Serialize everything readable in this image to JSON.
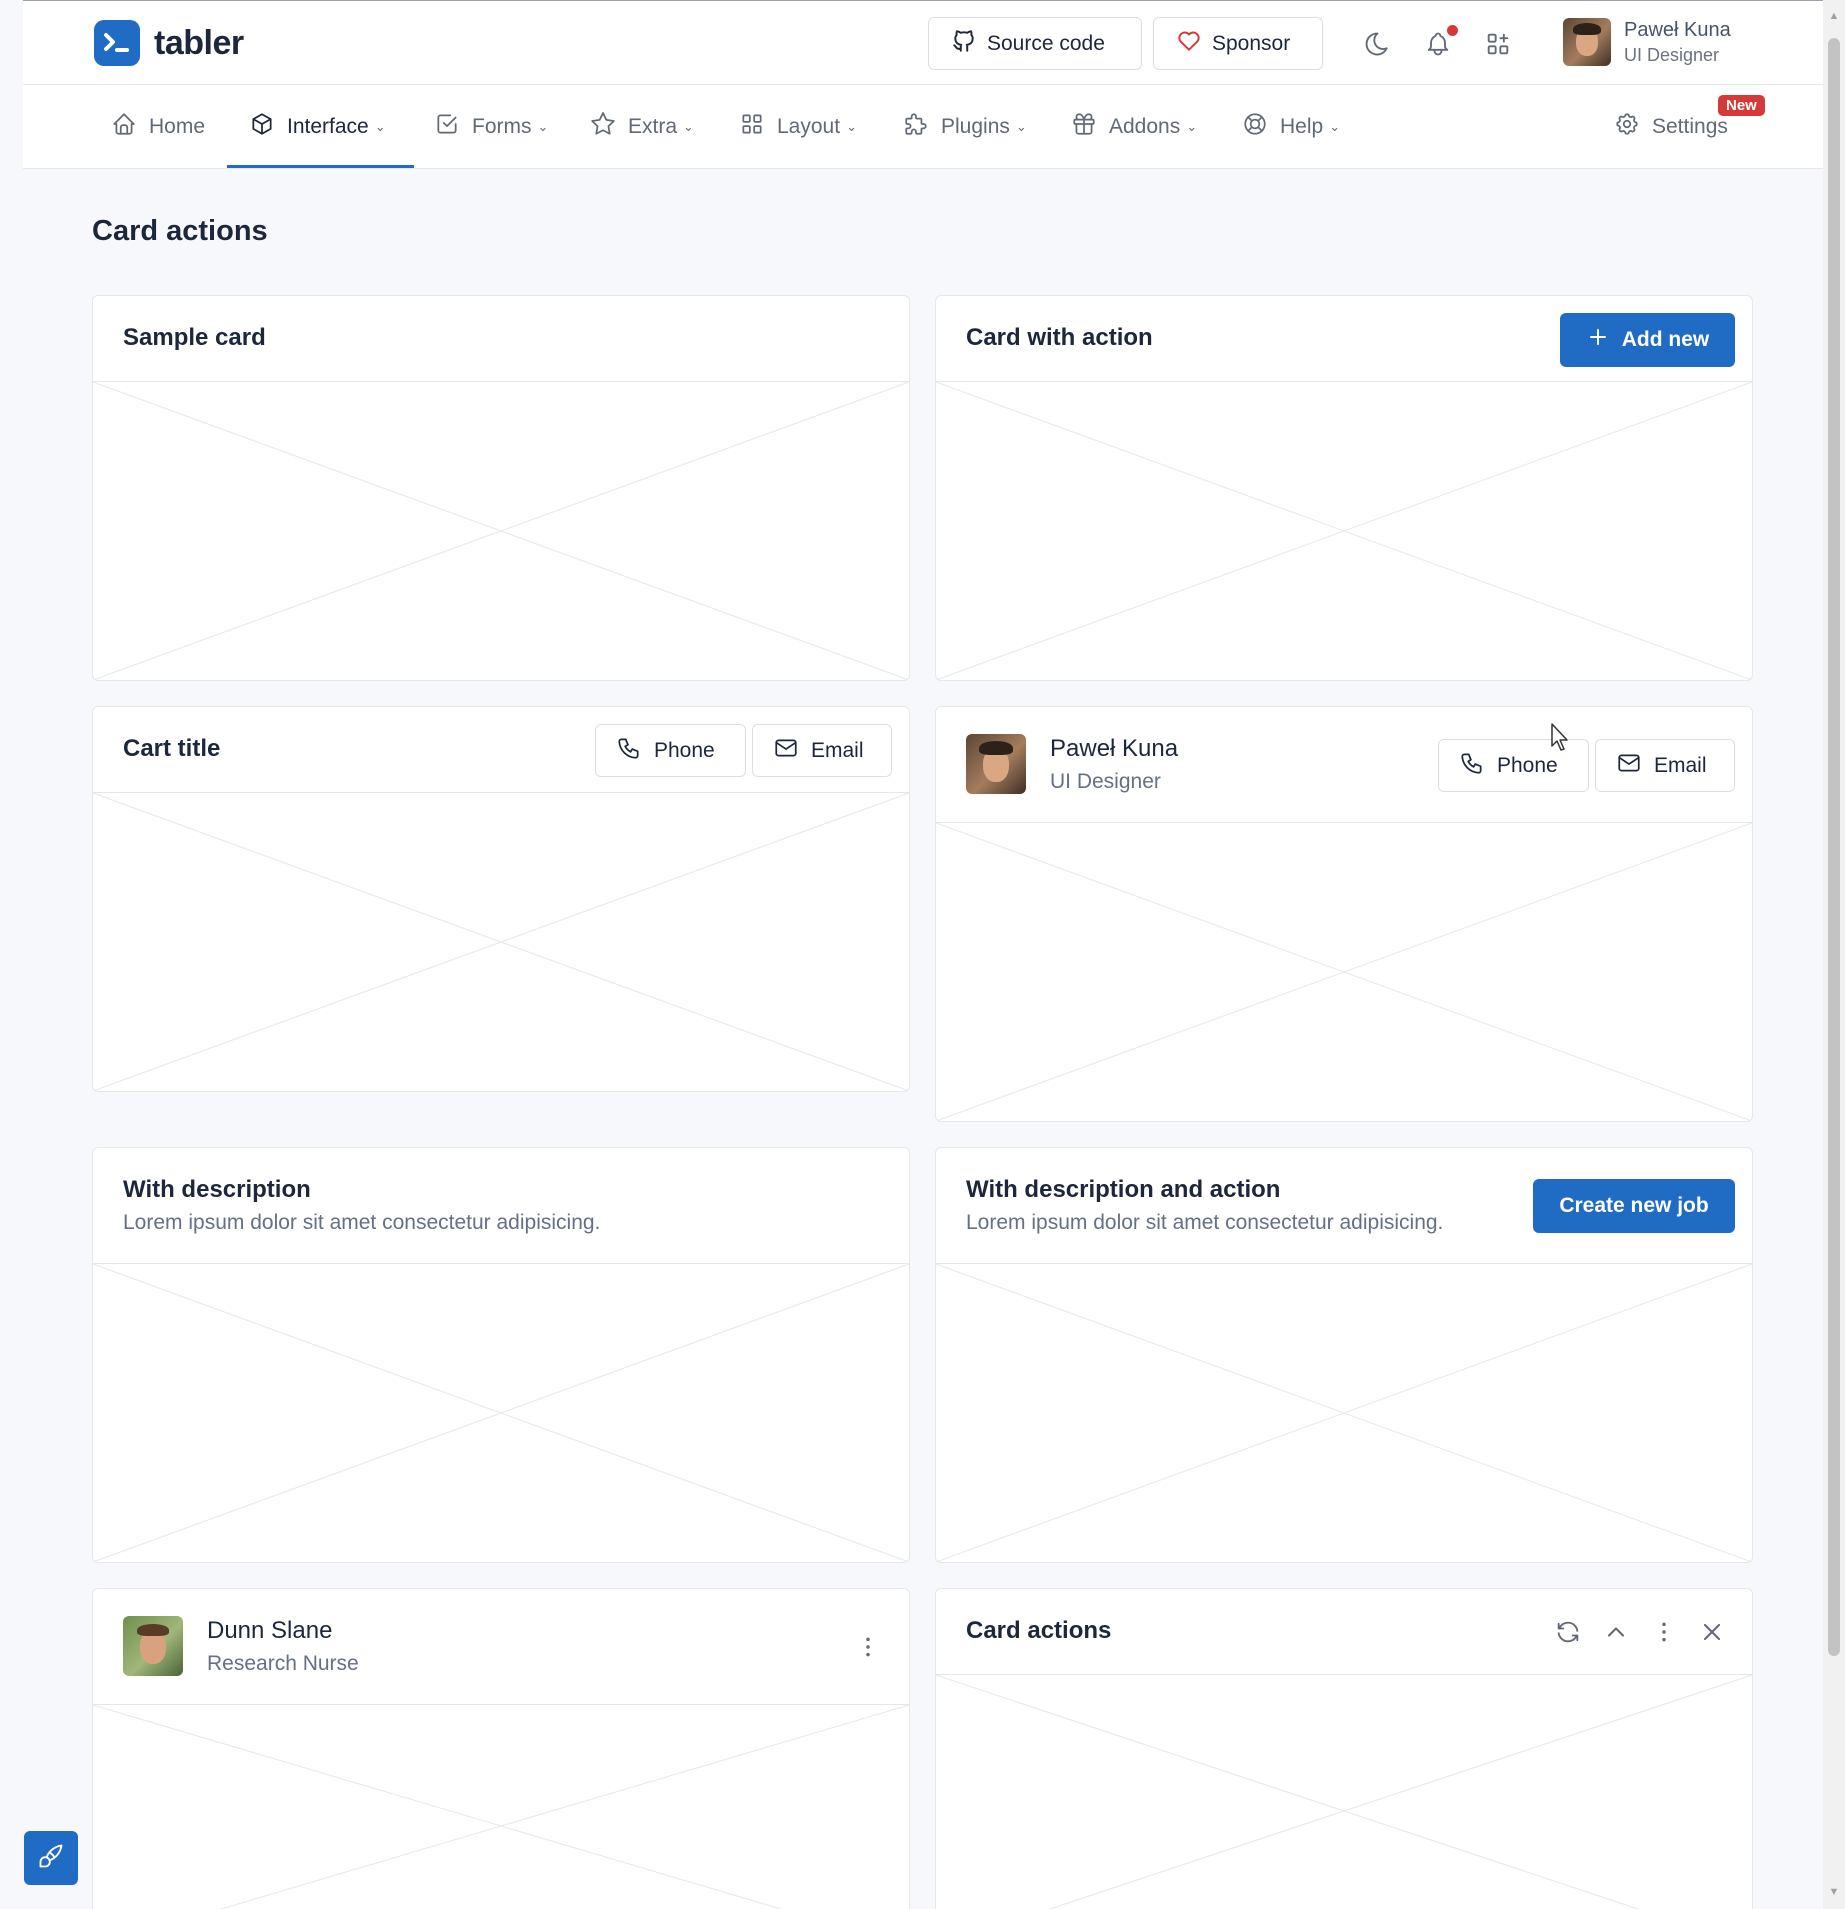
{
  "brand": {
    "name": "tabler"
  },
  "header": {
    "source_code": "Source code",
    "sponsor": "Sponsor",
    "user": {
      "name": "Paweł Kuna",
      "role": "UI Designer"
    }
  },
  "nav": {
    "items": [
      {
        "label": "Home",
        "icon": "home-icon"
      },
      {
        "label": "Interface",
        "icon": "package-icon"
      },
      {
        "label": "Forms",
        "icon": "checkbox-icon"
      },
      {
        "label": "Extra",
        "icon": "star-icon"
      },
      {
        "label": "Layout",
        "icon": "layout-icon"
      },
      {
        "label": "Plugins",
        "icon": "puzzle-icon"
      },
      {
        "label": "Addons",
        "icon": "gift-icon"
      },
      {
        "label": "Help",
        "icon": "lifebuoy-icon"
      }
    ],
    "settings": "Settings",
    "badge": "New"
  },
  "page": {
    "title": "Card actions"
  },
  "cards": {
    "sample": {
      "title": "Sample card"
    },
    "with_action": {
      "title": "Card with action",
      "button": "Add new"
    },
    "cart": {
      "title": "Cart title",
      "phone": "Phone",
      "email": "Email"
    },
    "person": {
      "name": "Paweł Kuna",
      "role": "UI Designer",
      "phone": "Phone",
      "email": "Email"
    },
    "with_desc": {
      "title": "With description",
      "desc": "Lorem ipsum dolor sit amet consectetur adipisicing."
    },
    "with_desc_action": {
      "title": "With description and action",
      "desc": "Lorem ipsum dolor sit amet consectetur adipisicing.",
      "button": "Create new job"
    },
    "dunn": {
      "name": "Dunn Slane",
      "role": "Research Nurse"
    },
    "actions": {
      "title": "Card actions"
    }
  },
  "colors": {
    "primary": "#206bc4",
    "danger": "#d63939"
  }
}
